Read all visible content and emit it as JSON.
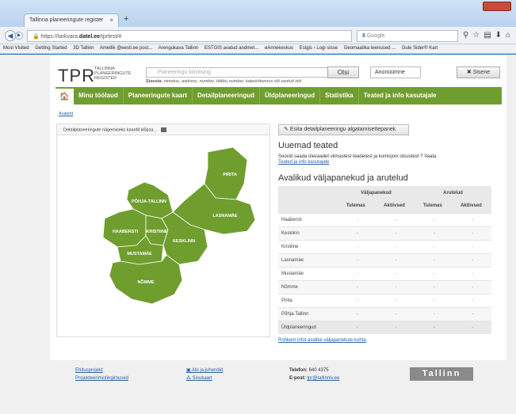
{
  "browser": {
    "tab_title": "Tallinna planeeringute register",
    "tab_close": "×",
    "new_tab": "+",
    "url_plain": "https://tarkvara.",
    "url_bold": "datel.ee",
    "url_rest": "/tprtest/#",
    "search_engine": "Google",
    "bookmarks": [
      "Most Visited",
      "Getting Started",
      "3D Tallinn",
      "Ametlik @eesti.ee post...",
      "Arengukava Tallinn",
      "ESTGIS avatud andmet...",
      "eAnnekeskus",
      "Estgis › Logi sisse",
      "Geomaatika teenused ...",
      "Gule Sider® Kart"
    ]
  },
  "header": {
    "logo": "TPR",
    "logo_sub": "TALLINNA PLANEERINGUTE REGISTER",
    "search_placeholder": "Planeeringu kiirotsing",
    "search_hint_label": "Sisesta:",
    "search_hint_text": "nimetus, aadress, number, täiliku number, katastritunnus või seotud isik",
    "search_button": "Otsi",
    "user_value": "Anonüümne",
    "login_button": "Sisene"
  },
  "nav": {
    "home_icon": "home-icon",
    "items": [
      "Minu töölaud",
      "Planeeringute kaart",
      "Detailplaneeringud",
      "Üldplaneeringud",
      "Statistika",
      "Teated ja info kasutajale"
    ]
  },
  "breadcrumb": "Avaleht",
  "map": {
    "header": "Detailplaneeringute nägemiseks kaardil klõpsa...",
    "fill_color": "#6f9e2f",
    "districts": [
      "PIRITA",
      "PÕHJA-TALLINN",
      "LASNAMÄE",
      "HAABERSTI",
      "KRISTIINE",
      "KESKLINN",
      "MUSTAMÄE",
      "NÕMME"
    ]
  },
  "actions": {
    "proposal_button": "Esita detailplaneeringu algatamisettepanek"
  },
  "news": {
    "title": "Uuemad teated",
    "text": "Soovid saada ülevaadet viimastest teadetest ja komisjoni otsustest ? Vaata",
    "link": "Teated ja info kasutajale"
  },
  "table": {
    "title": "Avalikud väljapanekud ja arutelud",
    "group_headers": [
      "Väljapanekud",
      "Arutelud"
    ],
    "sub_headers": [
      "Tulemas",
      "Aktiivsed",
      "Tulemas",
      "Aktiivsed"
    ],
    "rows": [
      {
        "name": "Haabersti",
        "values": [
          "-",
          "-",
          "-",
          "-"
        ]
      },
      {
        "name": "Kesklinn",
        "values": [
          "-",
          "-",
          "-",
          "-"
        ]
      },
      {
        "name": "Kristiine",
        "values": [
          "-",
          "-",
          "-",
          "-"
        ]
      },
      {
        "name": "Lasnamäe",
        "values": [
          "-",
          "-",
          "-",
          "-"
        ]
      },
      {
        "name": "Mustamäe",
        "values": [
          "-",
          "-",
          "-",
          "-"
        ]
      },
      {
        "name": "Nõmme",
        "values": [
          "-",
          "-",
          "-",
          "-"
        ]
      },
      {
        "name": "Pirita",
        "values": [
          "-",
          "-",
          "-",
          "-"
        ]
      },
      {
        "name": "Põhja-Tallinn",
        "values": [
          "-",
          "-",
          "-",
          "-"
        ]
      },
      {
        "name": "Üldplaneeringud",
        "values": [
          "-",
          "-",
          "-",
          "-"
        ]
      }
    ],
    "more_link": "Rohkem infot avalike väljapanekute kohta"
  },
  "footer": {
    "links_col1": [
      "Ehitusprojekt",
      "Projekteerimistingimused"
    ],
    "links_col2": [
      "Abi ja juhendid",
      "Sisukaart"
    ],
    "phone_label": "Telefon:",
    "phone_value": "640 4375",
    "email_label": "E-post:",
    "email_value": "tpr@tallinnlv.ee",
    "city_logo": "Tallinn"
  }
}
